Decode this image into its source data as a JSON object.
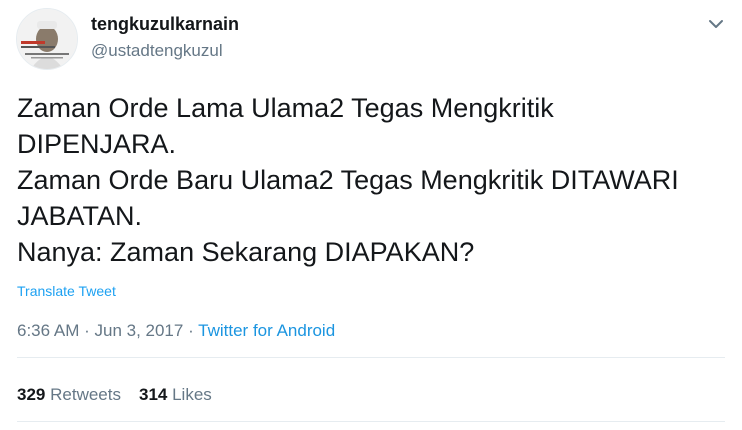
{
  "user": {
    "name": "tengkuzulkarnain",
    "handle": "@ustadtengkuzul"
  },
  "tweet": {
    "lines": [
      "Zaman Orde Lama Ulama2 Tegas Mengkritik",
      "DIPENJARA.",
      "Zaman Orde Baru Ulama2 Tegas Mengkritik DITAWARI",
      "JABATAN.",
      "Nanya: Zaman Sekarang DIAPAKAN?"
    ],
    "translate_label": "Translate Tweet"
  },
  "meta": {
    "time": "6:36 AM",
    "sep1": " · ",
    "date": "Jun 3, 2017",
    "sep2": " · ",
    "source": "Twitter for Android"
  },
  "stats": {
    "retweets_count": "329",
    "retweets_label": "Retweets",
    "likes_count": "314",
    "likes_label": "Likes"
  },
  "icons": {
    "caret": "chevron-down-icon",
    "avatar": "avatar"
  },
  "colors": {
    "link": "#1da1f2",
    "source_link": "#1b95e0",
    "secondary_text": "#657786",
    "primary_text": "#14171a",
    "divider": "#e6ecf0"
  }
}
